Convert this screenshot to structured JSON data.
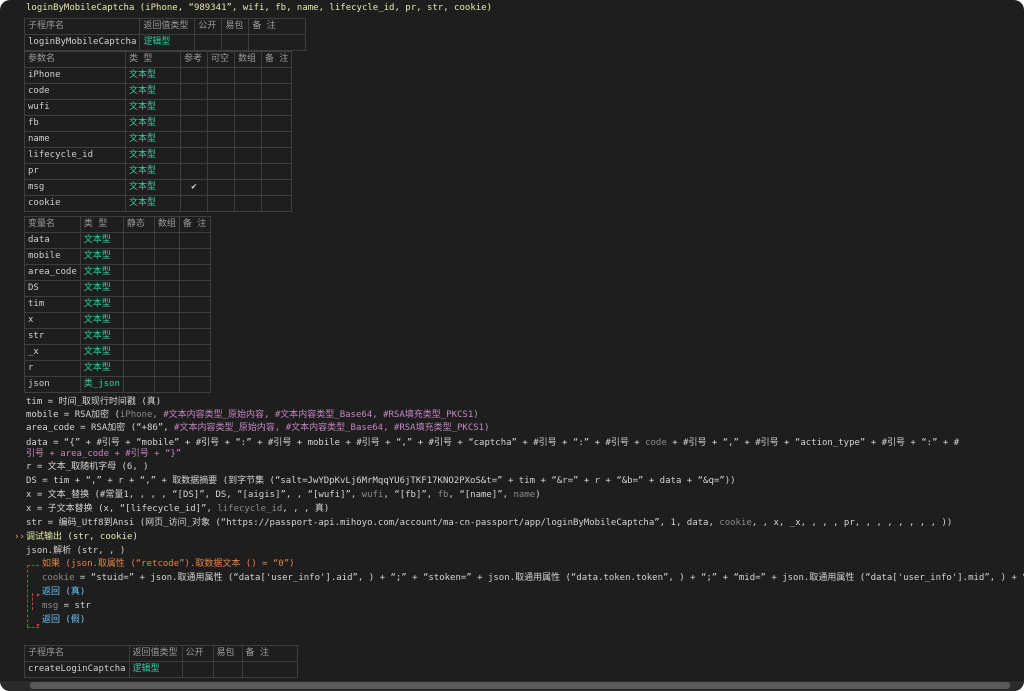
{
  "header": {
    "signature": "loginByMobileCaptcha (iPhone, “989341”, wifi, fb, name, lifecycle_id, pr, str, cookie)"
  },
  "sub_table": {
    "headers": [
      "子程序名",
      "返回值类型",
      "公开",
      "易包",
      "备 注"
    ],
    "row": [
      "loginByMobileCaptcha",
      "逻辑型",
      "",
      "",
      ""
    ]
  },
  "param_table": {
    "headers": [
      "参数名",
      "类 型",
      "参考",
      "可空",
      "数组",
      "备 注"
    ],
    "rows": [
      {
        "name": "iPhone",
        "type": "文本型",
        "check": ""
      },
      {
        "name": "code",
        "type": "文本型",
        "check": ""
      },
      {
        "name": "wufi",
        "type": "文本型",
        "check": ""
      },
      {
        "name": "fb",
        "type": "文本型",
        "check": ""
      },
      {
        "name": "name",
        "type": "文本型",
        "check": ""
      },
      {
        "name": "lifecycle_id",
        "type": "文本型",
        "check": ""
      },
      {
        "name": "pr",
        "type": "文本型",
        "check": ""
      },
      {
        "name": "msg",
        "type": "文本型",
        "check": "✔"
      },
      {
        "name": "cookie",
        "type": "文本型",
        "check": ""
      }
    ]
  },
  "var_table": {
    "headers": [
      "变量名",
      "类 型",
      "静态",
      "数组",
      "备 注"
    ],
    "rows": [
      {
        "name": "data",
        "type": "文本型"
      },
      {
        "name": "mobile",
        "type": "文本型"
      },
      {
        "name": "area_code",
        "type": "文本型"
      },
      {
        "name": "DS",
        "type": "文本型"
      },
      {
        "name": "tim",
        "type": "文本型"
      },
      {
        "name": "x",
        "type": "文本型"
      },
      {
        "name": "str",
        "type": "文本型"
      },
      {
        "name": "_x",
        "type": "文本型"
      },
      {
        "name": "r",
        "type": "文本型"
      },
      {
        "name": "json",
        "type": "类_json"
      }
    ]
  },
  "code": {
    "l1": "tim = 时间_取现行时间戳 (真)",
    "l2a": "mobile = RSA加密 (",
    "l2b": "iPhone",
    "l2c": ", #文本内容类型_原始内容, #文本内容类型_Base64, #RSA填充类型_PKCS1)",
    "l3a": "area_code = RSA加密 (“+86”, ",
    "l3b": "#文本内容类型_原始内容, #文本内容类型_Base64, #RSA填充类型_PKCS1)",
    "l4a": "data = “{” + #引号 + “mobile” + #引号 + “:” + #引号 + mobile + #引号 + “,” + #引号 + “captcha” + #引号 + “:” + #引号 + ",
    "l4b": "code",
    "l4c": " + #引号 + “,” + #引号 + “action_type” + #引号 + “:” + #",
    "l5": "引号 + area_code + #引号 + “}”",
    "l6": "r = 文本_取随机字母 (6, )",
    "l7": "DS = tim + “,” + r + “,” + 取数据摘要 (到字节集 (“salt=JwYDpKvLj6MrMqqYU6jTKF17KNO2PXoS&t=” + tim + “&r=” + r + “&b=” + data + “&q=”))",
    "l8a": "x = 文本_替换 (#常量1, , , , “[DS]”, DS, “[aigis]”, , “[wufi]”, ",
    "l8b": "wufi",
    "l8c": ", “[fb]”, ",
    "l8d": "fb",
    "l8e": ", “[name]”, ",
    "l8f": "name",
    "l8g": ")",
    "l9a": "x = 子文本替换 (x, “[lifecycle_id]”, ",
    "l9b": "lifecycle_id",
    "l9c": ", , , 真)",
    "l10a": "str = 编码_Utf8到Ansi (网页_访问_对象 (“https://passport-api.mihoyo.com/account/ma-cn-passport/app/loginByMobileCaptcha”, 1, data, ",
    "l10b": "cookie",
    "l10c": ", , x, _x, , , , pr, , , , , , , , ))",
    "l11": "调试输出 (str, cookie)",
    "l12": "json.解析 (str, , )",
    "l13": "如果 (json.取属性 (“retcode”).取数据文本 () = “0”)",
    "l14a": "cookie",
    "l14b": " = “stuid=” + json.取通用属性 (“data['user_info'].aid”, ) + “;” + “stoken=” + json.取通用属性 (“data.token.token”, ) + “;” + “mid=” + json.取通用属性 (“data['user_info'].mid”, ) + “",
    "l15": "返回 (真)",
    "l16a": "msg",
    "l16b": " = str",
    "l17": "返回 (假)"
  },
  "sub_table2": {
    "headers": [
      "子程序名",
      "返回值类型",
      "公开",
      "易包",
      "备 注"
    ],
    "row": [
      "createLoginCaptcha",
      "逻辑型",
      "",
      "",
      ""
    ]
  },
  "colors": {
    "background": "#1e1e1e",
    "type_green": "#2ed1a3",
    "keyword_orange": "#e6824a",
    "constant_purple": "#c586c0",
    "flow_red": "#d03a3a"
  }
}
